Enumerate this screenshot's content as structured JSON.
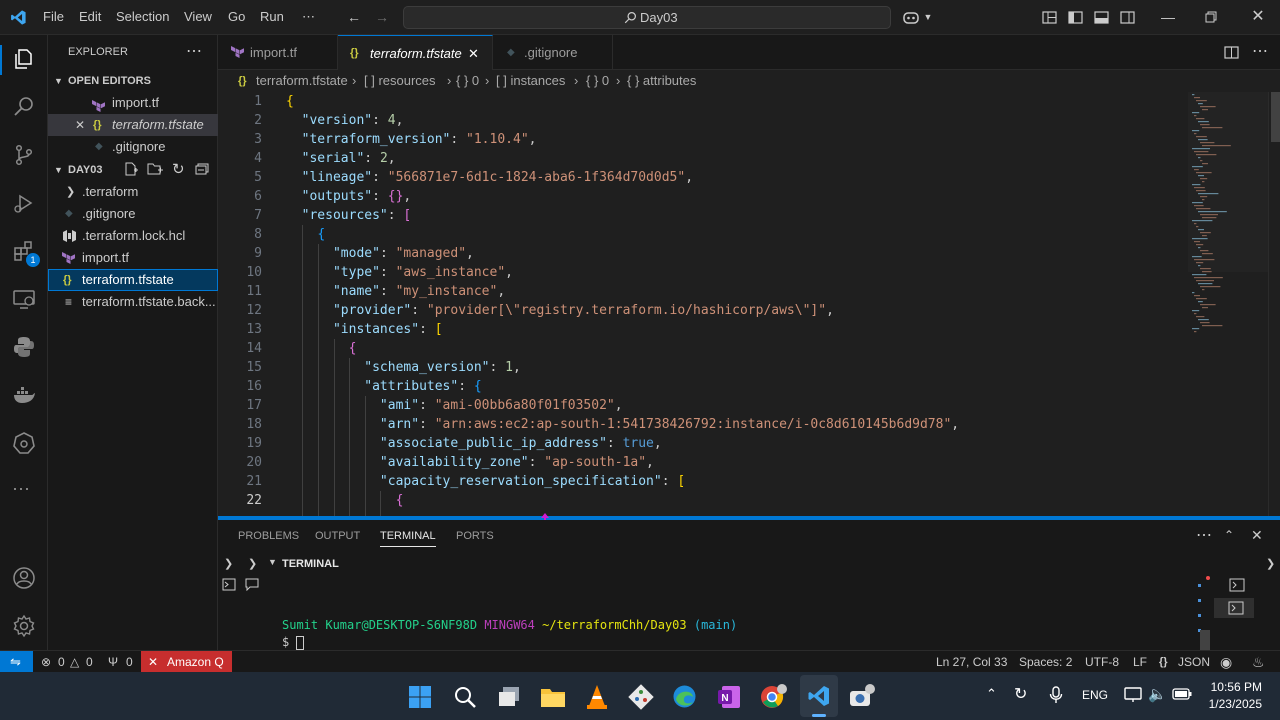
{
  "titlebar": {
    "menu": [
      "File",
      "Edit",
      "Selection",
      "View",
      "Go",
      "Run",
      "⋯"
    ],
    "search_text": "Day03"
  },
  "sidebar": {
    "title": "EXPLORER",
    "open_editors_label": "OPEN EDITORS",
    "open_editors": [
      "import.tf",
      "terraform.tfstate",
      ".gitignore"
    ],
    "folder_label": "DAY03",
    "files": [
      ".terraform",
      ".gitignore",
      ".terraform.lock.hcl",
      "import.tf",
      "terraform.tfstate",
      "terraform.tfstate.back..."
    ],
    "extensions_badge": "1"
  },
  "tabs": [
    {
      "label": "import.tf"
    },
    {
      "label": "terraform.tfstate"
    },
    {
      "label": ".gitignore"
    }
  ],
  "breadcrumb": [
    "terraform.tfstate",
    "[ ] resources",
    "{ } 0",
    "[ ] instances",
    "{ } 0",
    "{ } attributes"
  ],
  "editor": {
    "line_numbers": [
      "1",
      "2",
      "3",
      "4",
      "5",
      "6",
      "7",
      "8",
      "9",
      "10",
      "11",
      "12",
      "13",
      "14",
      "15",
      "16",
      "17",
      "18",
      "19",
      "20",
      "21",
      "22"
    ],
    "lines": [
      {
        "indent": "",
        "k": "",
        "v": "{",
        "vt": "br1"
      },
      {
        "indent": "  ",
        "k": "\"version\"",
        "v": "4",
        "vt": "n",
        "t": ","
      },
      {
        "indent": "  ",
        "k": "\"terraform_version\"",
        "v": "\"1.10.4\"",
        "vt": "s",
        "t": ","
      },
      {
        "indent": "  ",
        "k": "\"serial\"",
        "v": "2",
        "vt": "n",
        "t": ","
      },
      {
        "indent": "  ",
        "k": "\"lineage\"",
        "v": "\"566871e7-6d1c-1824-aba6-1f364d70d0d5\"",
        "vt": "s",
        "t": ","
      },
      {
        "indent": "  ",
        "k": "\"outputs\"",
        "v": "{}",
        "vt": "br2",
        "t": ","
      },
      {
        "indent": "  ",
        "k": "\"resources\"",
        "v": "[",
        "vt": "br2"
      },
      {
        "indent": "    ",
        "k": "",
        "v": "{",
        "vt": "br3"
      },
      {
        "indent": "      ",
        "k": "\"mode\"",
        "v": "\"managed\"",
        "vt": "s",
        "t": ","
      },
      {
        "indent": "      ",
        "k": "\"type\"",
        "v": "\"aws_instance\"",
        "vt": "s",
        "t": ","
      },
      {
        "indent": "      ",
        "k": "\"name\"",
        "v": "\"my_instance\"",
        "vt": "s",
        "t": ","
      },
      {
        "indent": "      ",
        "k": "\"provider\"",
        "v": "\"provider[\\\"registry.terraform.io/hashicorp/aws\\\"]\"",
        "vt": "s",
        "t": ","
      },
      {
        "indent": "      ",
        "k": "\"instances\"",
        "v": "[",
        "vt": "br1"
      },
      {
        "indent": "        ",
        "k": "",
        "v": "{",
        "vt": "br2"
      },
      {
        "indent": "          ",
        "k": "\"schema_version\"",
        "v": "1",
        "vt": "n",
        "t": ","
      },
      {
        "indent": "          ",
        "k": "\"attributes\"",
        "v": "{",
        "vt": "br3"
      },
      {
        "indent": "            ",
        "k": "\"ami\"",
        "v": "\"ami-00bb6a80f01f03502\"",
        "vt": "s",
        "t": ","
      },
      {
        "indent": "            ",
        "k": "\"arn\"",
        "v": "\"arn:aws:ec2:ap-south-1:541738426792:instance/i-0c8d610145b6d9d78\"",
        "vt": "s",
        "t": ","
      },
      {
        "indent": "            ",
        "k": "\"associate_public_ip_address\"",
        "v": "true",
        "vt": "b",
        "t": ","
      },
      {
        "indent": "            ",
        "k": "\"availability_zone\"",
        "v": "\"ap-south-1a\"",
        "vt": "s",
        "t": ","
      },
      {
        "indent": "            ",
        "k": "\"capacity_reservation_specification\"",
        "v": "[",
        "vt": "br1"
      },
      {
        "indent": "              ",
        "k": "",
        "v": "{",
        "vt": "br2"
      }
    ]
  },
  "panel": {
    "tabs": [
      "PROBLEMS",
      "OUTPUT",
      "TERMINAL",
      "PORTS"
    ],
    "terminal_label": "TERMINAL",
    "prompt_user": "Sumit Kumar@DESKTOP-S6NF98D",
    "prompt_shell": "MINGW64",
    "prompt_path": "~/terraformChh/Day03",
    "prompt_branch": "(main)",
    "prompt_symbol": "$"
  },
  "statusbar": {
    "errors": "0",
    "warnings": "0",
    "ports": "0",
    "amazon_q": "Amazon Q",
    "position": "Ln 27, Col 33",
    "spaces": "Spaces: 2",
    "encoding": "UTF-8",
    "eol": "LF",
    "language": "JSON"
  },
  "taskbar": {
    "lang": "ENG",
    "time": "10:56 PM",
    "date": "1/23/2025"
  },
  "colors": {
    "accent": "#0078d4",
    "amazon_q_bg": "#c72e2e",
    "remote_bg": "#0078d4"
  }
}
